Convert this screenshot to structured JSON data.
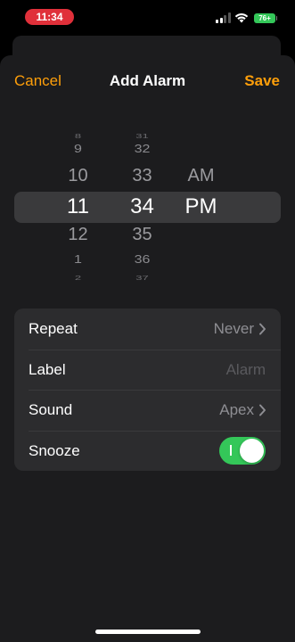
{
  "status_bar": {
    "time": "11:34",
    "battery": "76+",
    "time_pill_color": "#e0303a",
    "battery_color": "#34c759"
  },
  "nav": {
    "cancel_label": "Cancel",
    "title": "Add Alarm",
    "save_label": "Save",
    "accent_color": "#ff9f0a"
  },
  "picker": {
    "hours": {
      "above2": "8",
      "above1": "9",
      "near_above": "10",
      "selected": "11",
      "near_below": "12",
      "below1": "1",
      "below2": "2"
    },
    "minutes": {
      "above2": "31",
      "above1": "32",
      "near_above": "33",
      "selected": "34",
      "near_below": "35",
      "below1": "36",
      "below2": "37"
    },
    "period": {
      "near_above": "AM",
      "selected": "PM"
    }
  },
  "settings": {
    "repeat": {
      "label": "Repeat",
      "value": "Never"
    },
    "alarm_label": {
      "label": "Label",
      "placeholder": "Alarm"
    },
    "sound": {
      "label": "Sound",
      "value": "Apex"
    },
    "snooze": {
      "label": "Snooze",
      "enabled": true,
      "on_color": "#34c759"
    }
  }
}
